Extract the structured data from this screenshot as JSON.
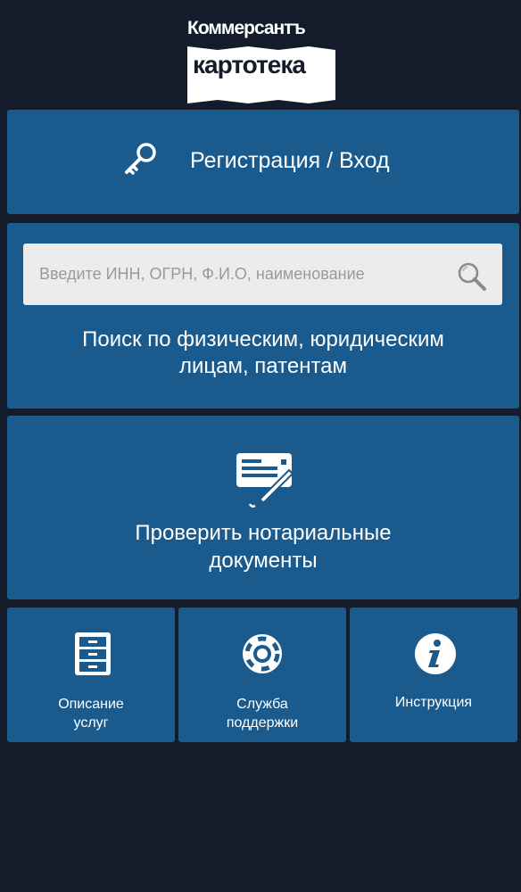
{
  "brand": {
    "top_word": "Коммерсантъ",
    "bottom_word": "картотека"
  },
  "login": {
    "label": "Регистрация / Вход",
    "icon": "key-icon"
  },
  "search": {
    "placeholder": "Введите ИНН, ОГРН, Ф.И.О, наименование",
    "value": "",
    "icon": "search-icon",
    "caption_line1": "Поиск по физическим, юридическим",
    "caption_line2": "лицам, патентам"
  },
  "notary": {
    "label_line1": "Проверить нотариальные",
    "label_line2": "документы",
    "icon": "document-pen-icon"
  },
  "tiles": [
    {
      "line1": "Описание",
      "line2": "услуг",
      "icon": "file-cabinet-icon"
    },
    {
      "line1": "Служба",
      "line2": "поддержки",
      "icon": "lifebuoy-icon"
    },
    {
      "line1": "Инструкция",
      "line2": "",
      "icon": "info-icon"
    }
  ],
  "colors": {
    "background": "#141c2b",
    "panel": "#1a5a8c",
    "search_field": "#ececec",
    "text": "#ffffff"
  }
}
